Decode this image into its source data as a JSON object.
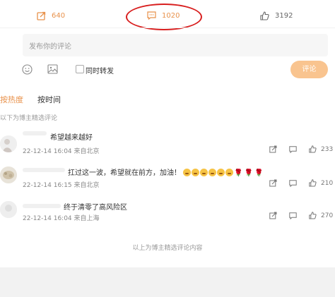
{
  "action_bar": {
    "repost_count": "640",
    "comment_count": "1020",
    "like_count": "3192",
    "accent_color": "#e8914a",
    "highlight_color": "#d81e1e"
  },
  "comment_input": {
    "placeholder": "发布你的评论",
    "repost_label": "同时转发",
    "submit_label": "评论"
  },
  "sort": {
    "hot_label": "按热度",
    "time_label": "按时间",
    "note": "以下为博主精选评论"
  },
  "comments": [
    {
      "text": "希望越来越好",
      "meta": "22-12-14 16:04 来自北京",
      "likes": "233"
    },
    {
      "text": "扛过这一波，希望就在前方，加油！",
      "meta": "22-12-14 16:15 来自北京",
      "likes": "210"
    },
    {
      "text": "终于清零了高风险区",
      "meta": "22-12-14 16:04 来自上海",
      "likes": "270"
    }
  ],
  "end_note": "以上为博主精选评论内容"
}
